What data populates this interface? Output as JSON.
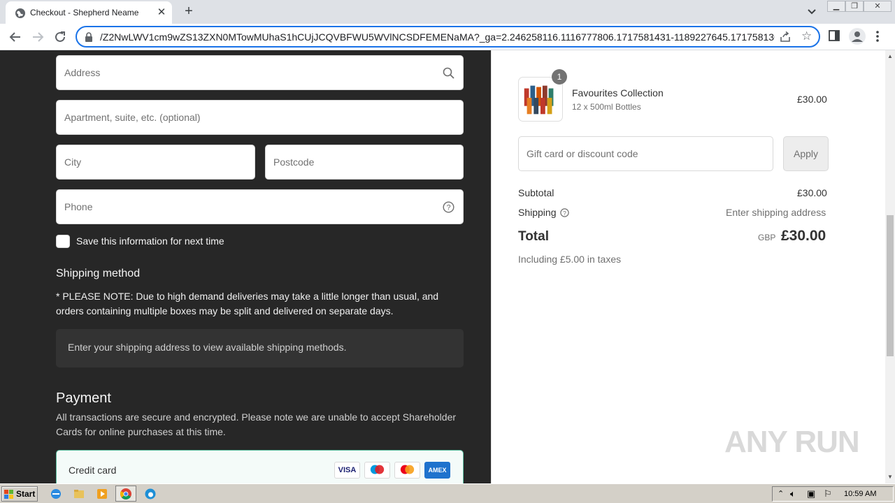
{
  "browser": {
    "tab_title": "Checkout - Shepherd Neame",
    "url": "/Z2NwLWV1cm9wZS13ZXN0MTowMUhaS1hCUjJCQVBFWU5WVlNCSDFEMENaMA?_ga=2.246258116.1116777806.1717581431-1189227645.1717581362"
  },
  "form": {
    "address_placeholder": "Address",
    "apartment_placeholder": "Apartment, suite, etc. (optional)",
    "city_placeholder": "City",
    "postcode_placeholder": "Postcode",
    "phone_placeholder": "Phone",
    "save_info_label": "Save this information for next time"
  },
  "shipping": {
    "heading": "Shipping method",
    "note": "* PLEASE NOTE: Due to high demand deliveries may take a little longer than usual, and orders containing multiple boxes may be split and delivered on separate days.",
    "placeholder_text": "Enter your shipping address to view available shipping methods."
  },
  "payment": {
    "heading": "Payment",
    "note": "All transactions are secure and encrypted. Please note we are unable to accept Shareholder Cards for online purchases at this time.",
    "method_label": "Credit card",
    "cards": [
      "VISA",
      "AMEX"
    ]
  },
  "summary": {
    "item": {
      "quantity": "1",
      "name": "Favourites Collection",
      "variant": "12 x 500ml Bottles",
      "price": "£30.00"
    },
    "discount_placeholder": "Gift card or discount code",
    "apply_label": "Apply",
    "subtotal_label": "Subtotal",
    "subtotal_value": "£30.00",
    "shipping_label": "Shipping",
    "shipping_value": "Enter shipping address",
    "total_label": "Total",
    "currency": "GBP",
    "total_value": "£30.00",
    "tax_note": "Including £5.00 in taxes"
  },
  "watermark": "ANY RUN",
  "taskbar": {
    "start_label": "Start",
    "clock": "10:59 AM"
  }
}
